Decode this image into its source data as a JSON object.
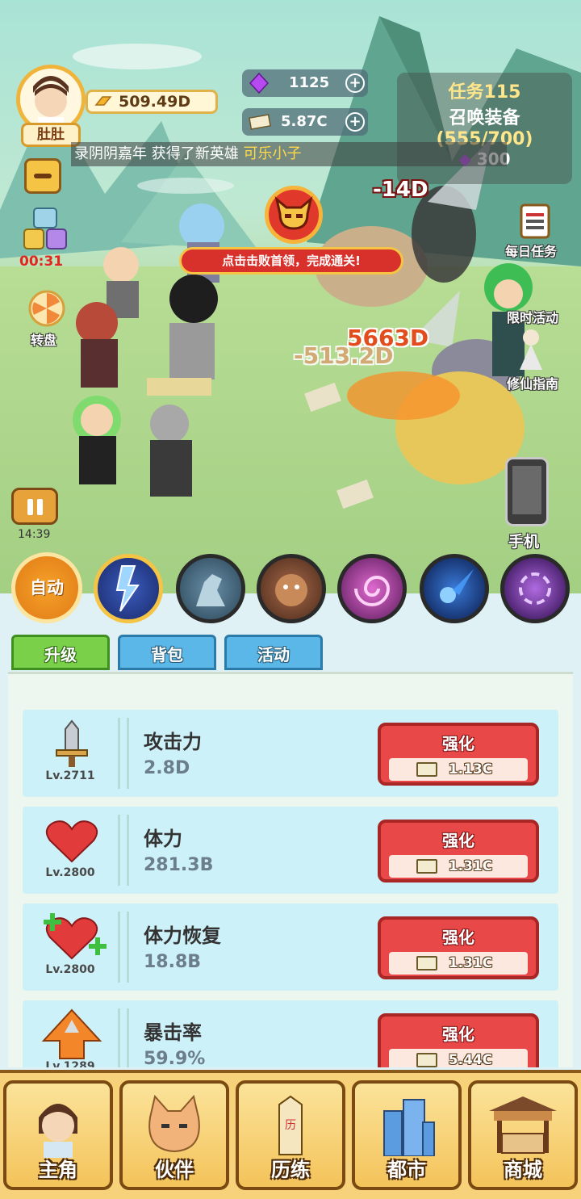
{
  "player": {
    "name": "肚肚",
    "gold": "509.49D"
  },
  "resources": {
    "gems": "1125",
    "cash": "5.87C"
  },
  "quest": {
    "title": "任务115",
    "name": "召唤装备",
    "progress": "(555/700)",
    "reward": "300"
  },
  "ticker": {
    "prefix": "录阴阴嘉年",
    "middle": " 获得了新英雄 ",
    "hero": "可乐小子"
  },
  "left_side": {
    "timer": "00:31",
    "wheel_label": "转盘",
    "pause_time": "14:39"
  },
  "right_side": {
    "daily_tasks": "每日任务",
    "limited_event": "限时活动",
    "guide": "修仙指南",
    "phone": "手机"
  },
  "boss": {
    "banner": "点击击败首领，完成通关!"
  },
  "damage_numbers": [
    "-14D",
    "5663D",
    "-513.2D"
  ],
  "skills": {
    "auto_label": "自动"
  },
  "tabs": [
    "升级",
    "背包",
    "活动"
  ],
  "upgrades": [
    {
      "name": "攻击力",
      "value": "2.8D",
      "level": "Lv.2711",
      "button": "强化",
      "cost": "1.13C",
      "icon": "sword-icon"
    },
    {
      "name": "体力",
      "value": "281.3B",
      "level": "Lv.2800",
      "button": "强化",
      "cost": "1.31C",
      "icon": "heart-icon"
    },
    {
      "name": "体力恢复",
      "value": "18.8B",
      "level": "Lv.2800",
      "button": "强化",
      "cost": "1.31C",
      "icon": "heart-plus-icon"
    },
    {
      "name": "暴击率",
      "value": "59.9%",
      "level": "Lv.1289",
      "button": "强化",
      "cost": "5.44C",
      "icon": "arrow-up-icon"
    }
  ],
  "nav": [
    "主角",
    "伙伴",
    "历练",
    "都市",
    "商城"
  ],
  "colors": {
    "accent_red": "#e84848",
    "tab_green": "#7bd04a",
    "tab_blue": "#5bb7e8",
    "gold": "#f4c35a"
  }
}
